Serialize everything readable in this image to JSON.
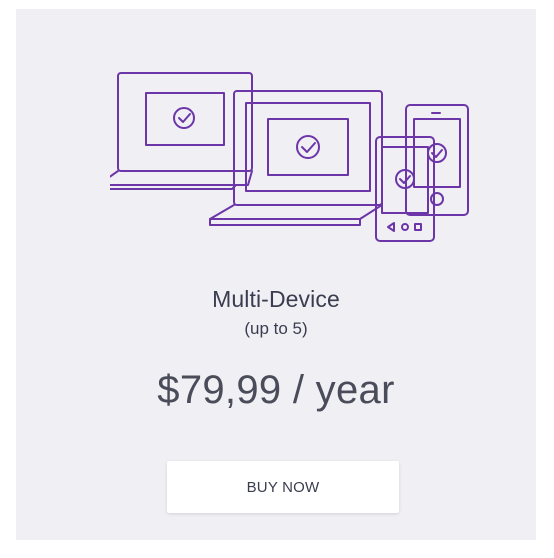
{
  "plan": {
    "name": "Multi-Device",
    "subtitle": "(up to 5)",
    "price": "$79,99 / year",
    "button_label": "BUY NOW"
  },
  "illustration": {
    "icon": "multi-device-icon",
    "stroke_color": "#6c36a8"
  },
  "colors": {
    "card_background": "#f0eff4",
    "text": "#3a3d4f",
    "button_background": "#ffffff"
  }
}
